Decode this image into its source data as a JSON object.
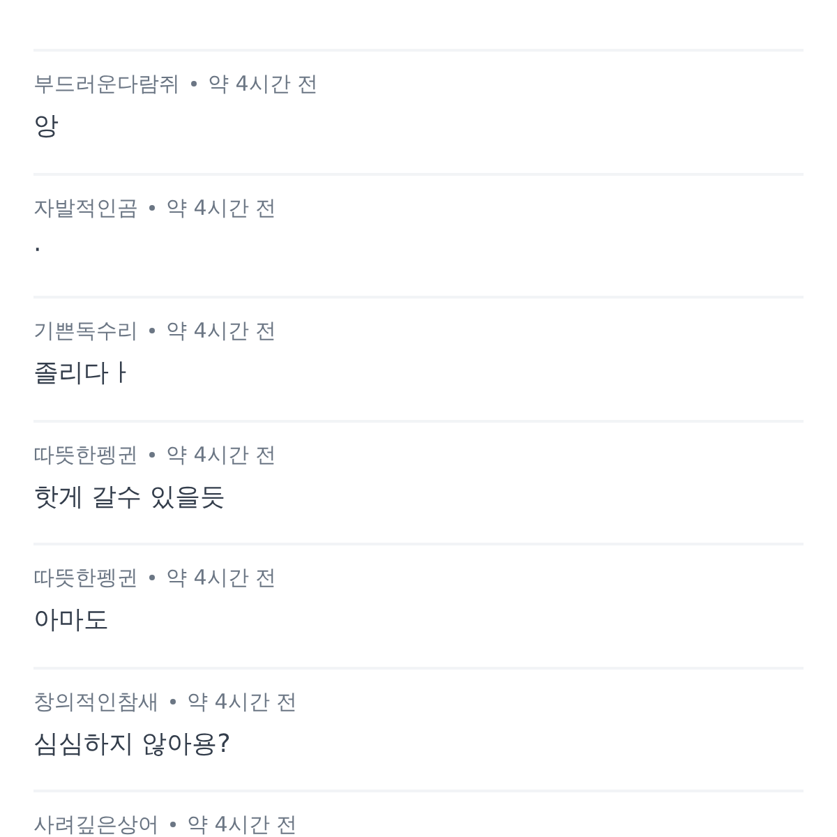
{
  "comments": [
    {
      "author": "부드러운다람쥐",
      "time": "약 4시간 전",
      "text": "앙"
    },
    {
      "author": "자발적인곰",
      "time": "약 4시간 전",
      "text": "·"
    },
    {
      "author": "기쁜독수리",
      "time": "약 4시간 전",
      "text": "졸리다ㅏ"
    },
    {
      "author": "따뜻한펭귄",
      "time": "약 4시간 전",
      "text": "핫게 갈수 있을듯"
    },
    {
      "author": "따뜻한펭귄",
      "time": "약 4시간 전",
      "text": "아마도"
    },
    {
      "author": "창의적인참새",
      "time": "약 4시간 전",
      "text": "심심하지 않아용?"
    },
    {
      "author": "사려깊은상어",
      "time": "약 4시간 전"
    }
  ]
}
